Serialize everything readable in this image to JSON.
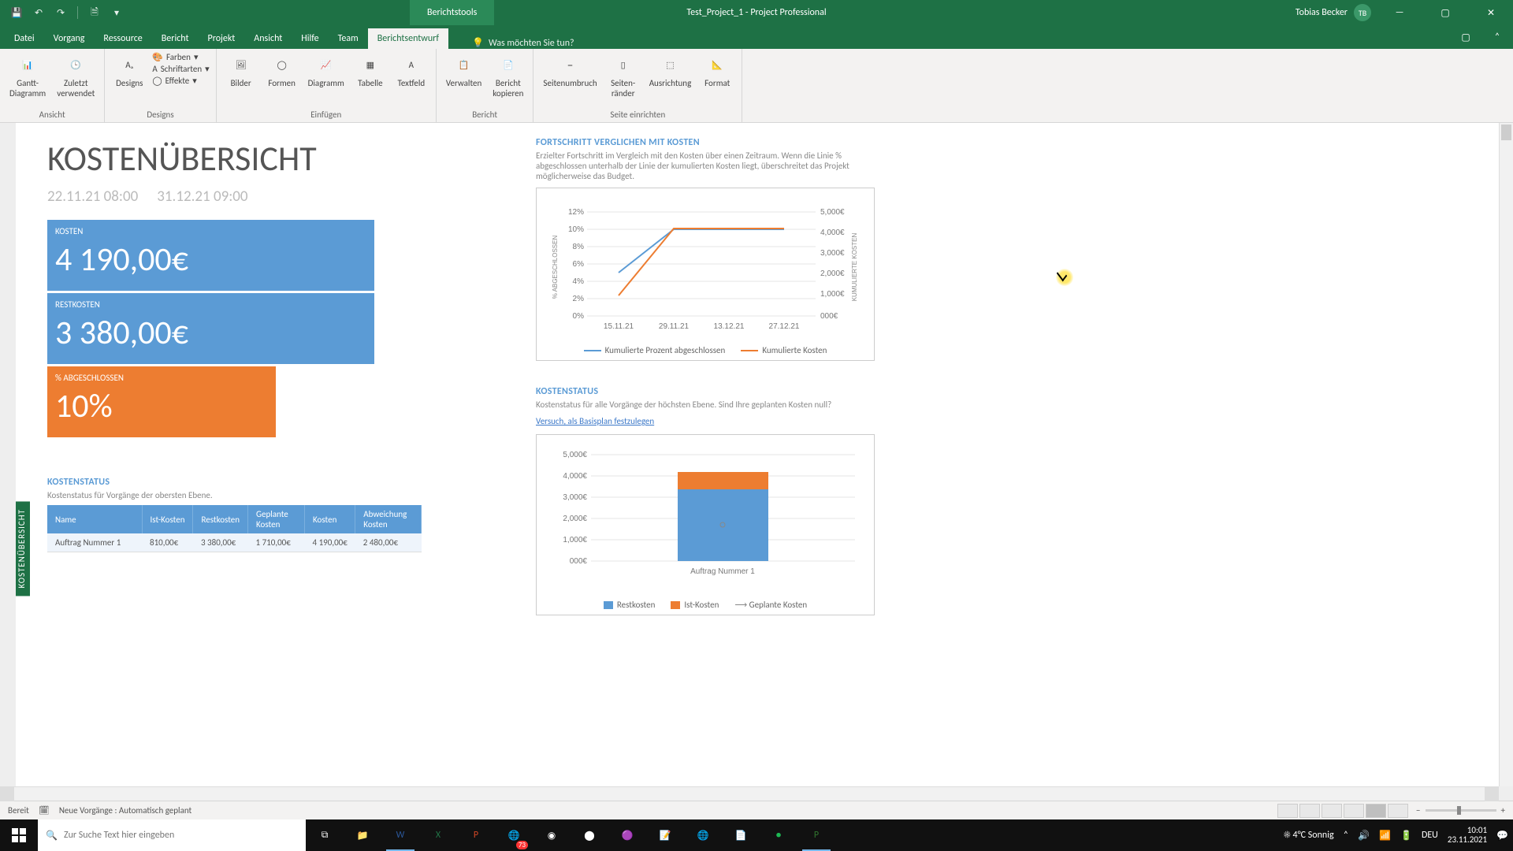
{
  "window": {
    "tools_tab": "Berichtstools",
    "doc_title": "Test_Project_1",
    "app_name": "Project Professional",
    "user_name": "Tobias Becker",
    "user_initials": "TB"
  },
  "ribbon_tabs": {
    "file": "Datei",
    "items": [
      "Vorgang",
      "Ressource",
      "Bericht",
      "Projekt",
      "Ansicht",
      "Hilfe",
      "Team",
      "Berichtsentwurf"
    ],
    "active": "Berichtsentwurf",
    "tellme": "Was möchten Sie tun?"
  },
  "ribbon": {
    "ansicht": {
      "gantt": "Gantt-\nDiagramm",
      "zuletzt": "Zuletzt\nverwendet",
      "label": "Ansicht"
    },
    "designs": {
      "designs": "Designs",
      "farben": "Farben",
      "schriftarten": "Schriftarten",
      "effekte": "Effekte",
      "label": "Designs"
    },
    "einfuegen": {
      "bilder": "Bilder",
      "formen": "Formen",
      "diagramm": "Diagramm",
      "tabelle": "Tabelle",
      "textfeld": "Textfeld",
      "label": "Einfügen"
    },
    "bericht": {
      "verwalten": "Verwalten",
      "kopieren": "Bericht\nkopieren",
      "label": "Bericht"
    },
    "seite": {
      "umbruch": "Seitenumbruch",
      "raender": "Seiten-\nränder",
      "ausrichtung": "Ausrichtung",
      "format": "Format",
      "label": "Seite einrichten"
    }
  },
  "report": {
    "side_tab": "KOSTENÜBERSICHT",
    "title": "KOSTENÜBERSICHT",
    "date_start": "22.11.21 08:00",
    "date_end": "31.12.21 09:00",
    "tile_kosten_label": "KOSTEN",
    "tile_kosten_value": "4 190,00€",
    "tile_rest_label": "RESTKOSTEN",
    "tile_rest_value": "3 380,00€",
    "tile_pct_label": "% ABGESCHLOSSEN",
    "tile_pct_value": "10%",
    "progress": {
      "title": "FORTSCHRITT VERGLICHEN MIT KOSTEN",
      "desc": "Erzielter Fortschritt im Vergleich mit den Kosten über einen Zeitraum. Wenn die Linie % abgeschlossen unterhalb der Linie der kumulierten Kosten liegt, überschreitet das Projekt möglicherweise das Budget.",
      "legend1": "Kumulierte Prozent abgeschlossen",
      "legend2": "Kumulierte Kosten",
      "y_left_label": "% ABGESCHLOSSEN",
      "y_right_label": "KUMULIERTE KOSTEN"
    },
    "status": {
      "title": "KOSTENSTATUS",
      "desc": "Kostenstatus für Vorgänge der obersten Ebene.",
      "table": {
        "headers": [
          "Name",
          "Ist-Kosten",
          "Restkosten",
          "Geplante Kosten",
          "Kosten",
          "Abweichung Kosten"
        ],
        "row": [
          "Auftrag Nummer 1",
          "810,00€",
          "3 380,00€",
          "1 710,00€",
          "4 190,00€",
          "2 480,00€"
        ]
      }
    },
    "status_chart": {
      "title": "KOSTENSTATUS",
      "desc": "Kostenstatus für alle Vorgänge der höchsten Ebene. Sind Ihre geplanten Kosten null?",
      "link": "Versuch, als Basisplan festzulegen",
      "legend_rest": "Restkosten",
      "legend_ist": "Ist-Kosten",
      "legend_plan": "Geplante Kosten",
      "category": "Auftrag Nummer 1"
    }
  },
  "chart_data": [
    {
      "type": "line",
      "name": "progress_vs_cost",
      "x": [
        "15.11.21",
        "29.11.21",
        "13.12.21",
        "27.12.21"
      ],
      "series": [
        {
          "name": "Kumulierte Prozent abgeschlossen",
          "axis": "left_pct",
          "values": [
            5,
            10,
            10,
            10
          ]
        },
        {
          "name": "Kumulierte Kosten",
          "axis": "right_euro",
          "values": [
            1000,
            4190,
            4190,
            4190
          ]
        }
      ],
      "y_left": {
        "label": "% ABGESCHLOSSEN",
        "ticks": [
          "0%",
          "2%",
          "4%",
          "6%",
          "8%",
          "10%",
          "12%"
        ],
        "range": [
          0,
          12
        ]
      },
      "y_right": {
        "label": "KUMULIERTE KOSTEN",
        "ticks": [
          "000€",
          "1,000€",
          "2,000€",
          "3,000€",
          "4,000€",
          "5,000€"
        ],
        "range": [
          0,
          5000
        ]
      }
    },
    {
      "type": "bar",
      "name": "cost_status_stacked",
      "categories": [
        "Auftrag Nummer 1"
      ],
      "series": [
        {
          "name": "Restkosten",
          "values": [
            3380
          ],
          "color": "#5b9bd5"
        },
        {
          "name": "Ist-Kosten",
          "values": [
            810
          ],
          "color": "#ed7d31"
        }
      ],
      "marker_series": {
        "name": "Geplante Kosten",
        "values": [
          1710
        ]
      },
      "y": {
        "ticks": [
          "000€",
          "1,000€",
          "2,000€",
          "3,000€",
          "4,000€",
          "5,000€"
        ],
        "range": [
          0,
          5000
        ]
      }
    }
  ],
  "statusbar": {
    "ready": "Bereit",
    "mode": "Neue Vorgänge : Automatisch geplant"
  },
  "taskbar": {
    "search_placeholder": "Zur Suche Text hier eingeben",
    "weather": "4°C  Sonnig",
    "lang": "DEU",
    "time": "10:01",
    "date": "23.11.2021"
  }
}
